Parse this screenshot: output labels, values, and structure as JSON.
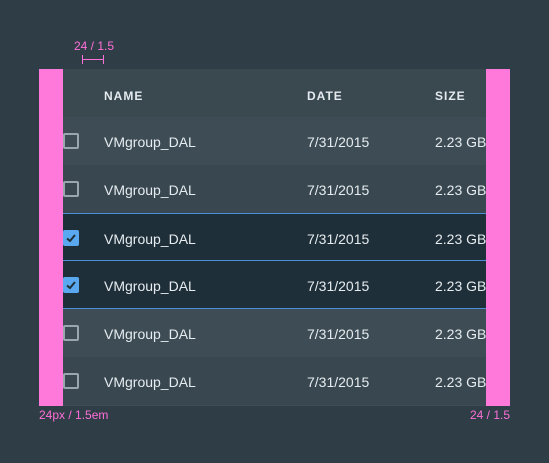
{
  "annotations": {
    "top_measure": "24 / 1.5",
    "bottom_left": "24px / 1.5em",
    "bottom_right": "24 / 1.5"
  },
  "colors": {
    "accent": "#5aa8f0",
    "annotation": "#ff6fd8",
    "background": "#2f3d47"
  },
  "table": {
    "columns": [
      "NAME",
      "DATE",
      "SIZE"
    ],
    "rows": [
      {
        "name": "VMgroup_DAL",
        "date": "7/31/2015",
        "size": "2.23 GB",
        "checked": false
      },
      {
        "name": "VMgroup_DAL",
        "date": "7/31/2015",
        "size": "2.23 GB",
        "checked": false
      },
      {
        "name": "VMgroup_DAL",
        "date": "7/31/2015",
        "size": "2.23 GB",
        "checked": true
      },
      {
        "name": "VMgroup_DAL",
        "date": "7/31/2015",
        "size": "2.23 GB",
        "checked": true
      },
      {
        "name": "VMgroup_DAL",
        "date": "7/31/2015",
        "size": "2.23 GB",
        "checked": false
      },
      {
        "name": "VMgroup_DAL",
        "date": "7/31/2015",
        "size": "2.23 GB",
        "checked": false
      }
    ]
  }
}
